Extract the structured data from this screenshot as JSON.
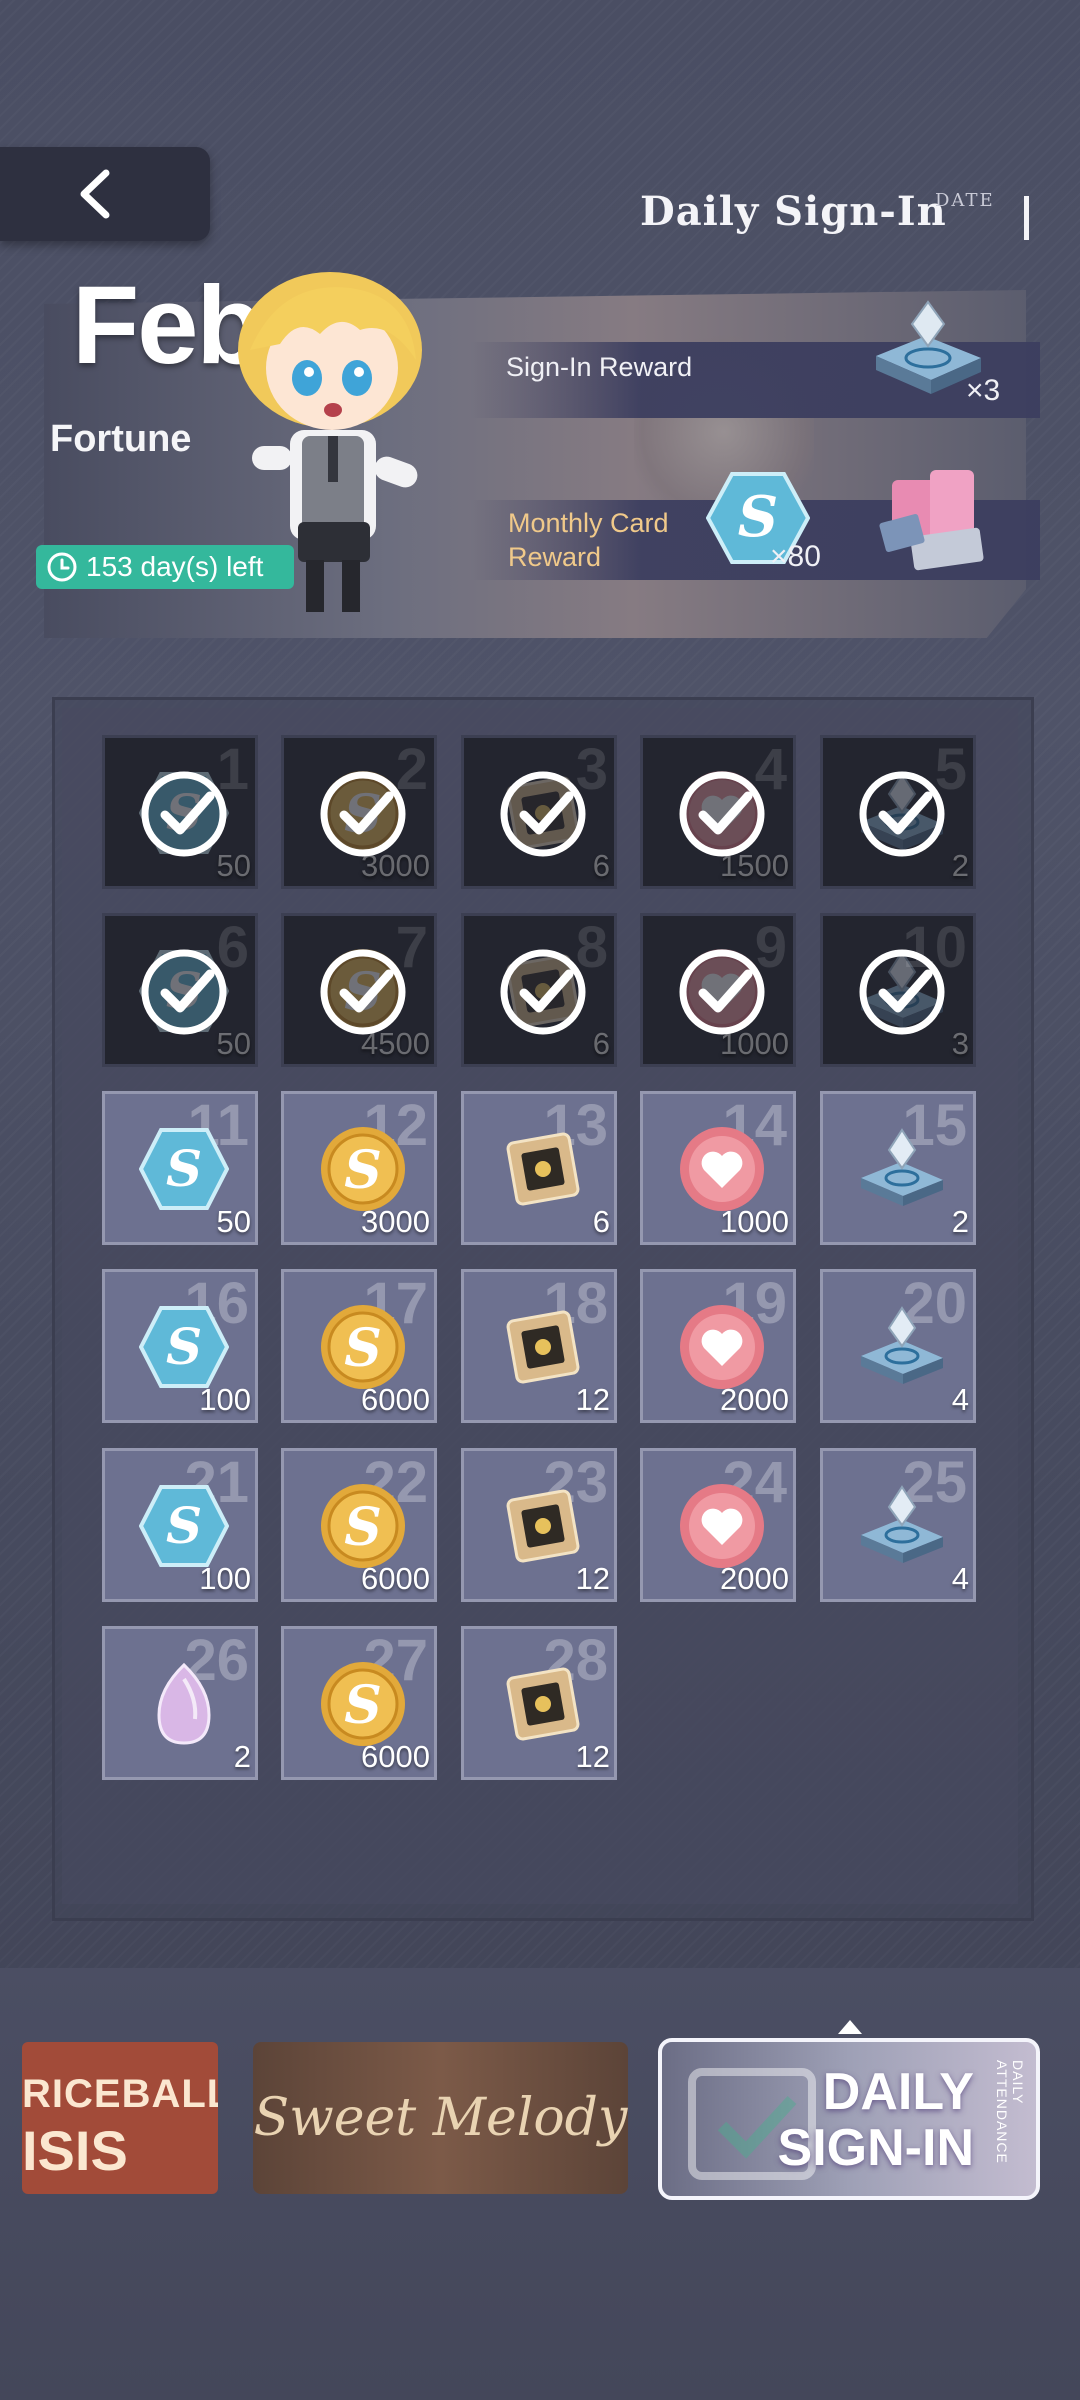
{
  "header": {
    "title": "Daily  Sign-In",
    "date_tag": "DATE"
  },
  "banner": {
    "month": "Feb",
    "theme": "Fortune",
    "days_left": "153 day(s) left",
    "sign_in_reward_label": "Sign-In Reward",
    "sign_in_reward_qty": "×3",
    "monthly_card_label_line1": "Monthly Card",
    "monthly_card_label_line2": "Reward",
    "monthly_card_qty": "×80"
  },
  "days": [
    {
      "day": "1",
      "amount": "50",
      "item": "crystal",
      "claimed": true
    },
    {
      "day": "2",
      "amount": "3000",
      "item": "coin",
      "claimed": true
    },
    {
      "day": "3",
      "amount": "6",
      "item": "chip",
      "claimed": true
    },
    {
      "day": "4",
      "amount": "1500",
      "item": "heart",
      "claimed": true
    },
    {
      "day": "5",
      "amount": "2",
      "item": "pad",
      "claimed": true
    },
    {
      "day": "6",
      "amount": "50",
      "item": "crystal",
      "claimed": true
    },
    {
      "day": "7",
      "amount": "4500",
      "item": "coin",
      "claimed": true
    },
    {
      "day": "8",
      "amount": "6",
      "item": "chip",
      "claimed": true
    },
    {
      "day": "9",
      "amount": "1000",
      "item": "heart",
      "claimed": true
    },
    {
      "day": "10",
      "amount": "3",
      "item": "pad",
      "claimed": true
    },
    {
      "day": "11",
      "amount": "50",
      "item": "crystal",
      "claimed": false
    },
    {
      "day": "12",
      "amount": "3000",
      "item": "coin",
      "claimed": false
    },
    {
      "day": "13",
      "amount": "6",
      "item": "chip",
      "claimed": false
    },
    {
      "day": "14",
      "amount": "1000",
      "item": "heart",
      "claimed": false
    },
    {
      "day": "15",
      "amount": "2",
      "item": "pad",
      "claimed": false
    },
    {
      "day": "16",
      "amount": "100",
      "item": "crystal",
      "claimed": false
    },
    {
      "day": "17",
      "amount": "6000",
      "item": "coin",
      "claimed": false
    },
    {
      "day": "18",
      "amount": "12",
      "item": "chip",
      "claimed": false
    },
    {
      "day": "19",
      "amount": "2000",
      "item": "heart",
      "claimed": false
    },
    {
      "day": "20",
      "amount": "4",
      "item": "pad",
      "claimed": false
    },
    {
      "day": "21",
      "amount": "100",
      "item": "crystal",
      "claimed": false
    },
    {
      "day": "22",
      "amount": "6000",
      "item": "coin",
      "claimed": false
    },
    {
      "day": "23",
      "amount": "12",
      "item": "chip",
      "claimed": false
    },
    {
      "day": "24",
      "amount": "2000",
      "item": "heart",
      "claimed": false
    },
    {
      "day": "25",
      "amount": "4",
      "item": "pad",
      "claimed": false
    },
    {
      "day": "26",
      "amount": "2",
      "item": "gem",
      "claimed": false
    },
    {
      "day": "27",
      "amount": "6000",
      "item": "coin",
      "claimed": false
    },
    {
      "day": "28",
      "amount": "12",
      "item": "chip",
      "claimed": false
    }
  ],
  "events": {
    "event1_line1": "RICEBALL",
    "event1_line2": "ISIS",
    "event2": "Sweet Melody",
    "event3_line1": "DAILY",
    "event3_line2": "SIGN-IN",
    "event3_side": "DAILY ATTENDANCE"
  },
  "colors": {
    "days_left_badge": "#34b89c",
    "monthly_card_text": "#f0c98a",
    "coin": "#e2a93a",
    "heart": "#e57a86",
    "crystal": "#5fb9d8"
  }
}
